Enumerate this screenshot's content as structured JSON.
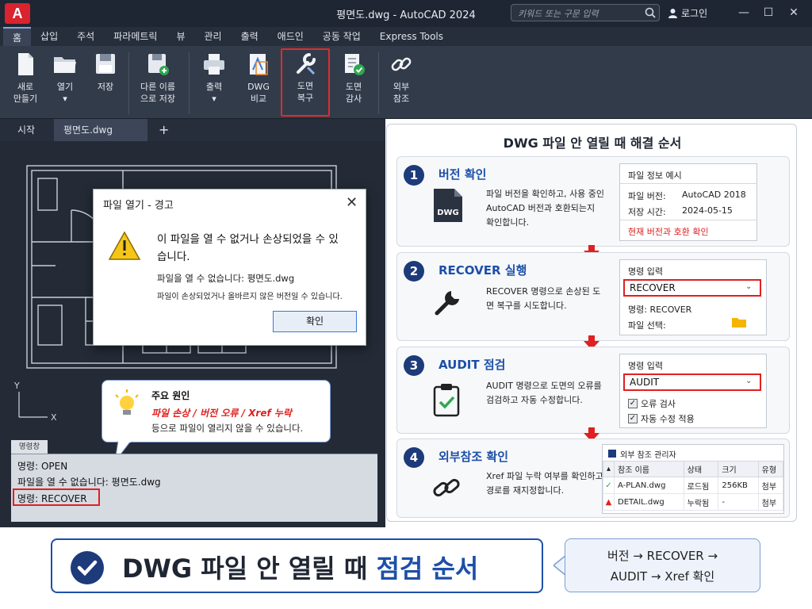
{
  "window": {
    "logo": "A",
    "title": "평면도.dwg - AutoCAD 2024",
    "search_placeholder": "키워드 또는 구문 입력",
    "login": "로그인"
  },
  "menu": [
    "홈",
    "삽입",
    "주석",
    "파라메트릭",
    "뷰",
    "관리",
    "출력",
    "애드인",
    "공동 작업",
    "Express Tools"
  ],
  "ribbon": {
    "new": [
      "새로",
      "만들기"
    ],
    "open": [
      "열기",
      "▾"
    ],
    "save": [
      "저장",
      ""
    ],
    "saveas": [
      "다른 이름",
      "으로 저장"
    ],
    "print": [
      "출력",
      "▾"
    ],
    "compare": [
      "DWG",
      "비교"
    ],
    "recover": [
      "도면",
      "복구"
    ],
    "audit": [
      "도면",
      "감사"
    ],
    "xref": [
      "외부",
      "참조"
    ]
  },
  "doc_tabs": {
    "start": "시작",
    "active": "평면도.dwg",
    "close": "×",
    "add": "+"
  },
  "dialog": {
    "title": "파일 열기 - 경고",
    "message": "이 파일을 열 수 없거나 손상되었을 수 있습니다.",
    "line1": "파일을 열 수 없습니다: 평면도.dwg",
    "line2": "파일이 손상되었거나 올바르지 않은 버전일 수 있습니다.",
    "ok": "확인"
  },
  "callout": {
    "title": "주요 원인",
    "causes": "파일 손상 / 버전 오류 / Xref 누락",
    "note": "등으로 파일이 열리지 않을 수 있습니다."
  },
  "axis": {
    "y": "Y",
    "x": "X"
  },
  "command": {
    "tab": "명령창",
    "lines": [
      "명령: OPEN",
      "파일을 열 수 없습니다: 평면도.dwg",
      "명령:  RECOVER"
    ]
  },
  "guide": {
    "title": "DWG 파일 안 열릴 때 해결 순서",
    "steps": [
      {
        "num": "1",
        "title": "버전 확인",
        "desc": "파일 버전을 확인하고, 사용 중인 AutoCAD 버전과 호환되는지 확인합니다.",
        "panel": {
          "title": "파일 정보 예시",
          "k1": "파일 버전:",
          "v1": "AutoCAD 2018",
          "k2": "저장 시간:",
          "v2": "2024-05-15",
          "status": "현재 버전과 호환 확인"
        }
      },
      {
        "num": "2",
        "title": "RECOVER 실행",
        "desc": "RECOVER 명령으로 손상된 도면 복구를 시도합니다.",
        "panel": {
          "title": "명령 입력",
          "value": "RECOVER",
          "l1": "명령: RECOVER",
          "l2": "파일 선택:"
        }
      },
      {
        "num": "3",
        "title": "AUDIT 점검",
        "desc": "AUDIT 명령으로 도면의 오류를 검검하고 자동 수정합니다.",
        "panel": {
          "title": "명령 입력",
          "value": "AUDIT",
          "c1": "오류 검사",
          "c2": "자동 수정 적용"
        }
      },
      {
        "num": "4",
        "title": "외부참조 확인",
        "desc": "Xref 파일 누락 여부를 확인하고 경로를 재지정합니다.",
        "panel": {
          "title": "외부 참조 관리자",
          "headers": [
            "참조 이름",
            "상태",
            "크기",
            "유형"
          ],
          "rows": [
            [
              "A-PLAN.dwg",
              "로드됨",
              "256KB",
              "첨부"
            ],
            [
              "DETAIL.dwg",
              "누락됨",
              "-",
              "첨부"
            ]
          ]
        }
      }
    ]
  },
  "footer": {
    "part1": "DWG 파일 안 열릴 때 ",
    "part2": "점검 순서",
    "note1": "버전 → RECOVER →",
    "note2": "AUDIT → Xref 확인"
  },
  "colors": {
    "accent": "#1d4fa8",
    "alert": "#e02020",
    "titlebar": "#1f2633"
  }
}
